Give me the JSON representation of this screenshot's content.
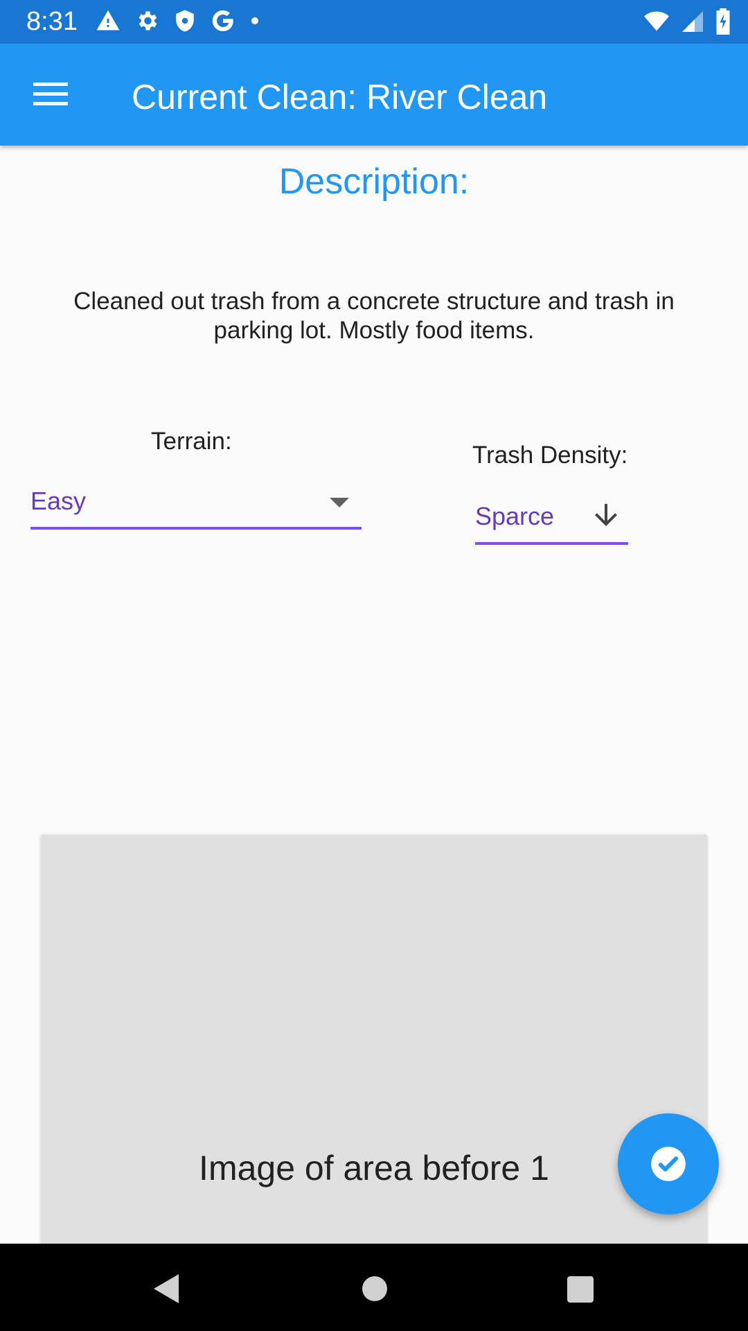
{
  "status_bar": {
    "time": "8:31",
    "left_icons": [
      "alert-icon",
      "settings-icon",
      "shield-icon",
      "google-icon",
      "dot-icon"
    ],
    "right_icons": [
      "wifi-icon",
      "signal-icon",
      "battery-icon"
    ]
  },
  "app_bar": {
    "title": "Current Clean: River Clean",
    "menu_icon": "menu-icon",
    "color": "#2196f3"
  },
  "description": {
    "heading": "Description:",
    "text": "Cleaned out trash from a concrete structure and trash in parking lot. Mostly food items."
  },
  "terrain": {
    "label": "Terrain:",
    "value": "Easy"
  },
  "trash_density": {
    "label": "Trash Density:",
    "value": "Sparce"
  },
  "image_card": {
    "caption": "Image of area before 1"
  },
  "fab": {
    "icon": "check-circle-icon"
  },
  "nav_bar": {
    "icons": [
      "back-icon",
      "home-icon",
      "recents-icon"
    ]
  },
  "colors": {
    "status_bar": "#1976d2",
    "accent": "#2196f3",
    "dropdown_value": "#673ab7",
    "underline": "#7c4dff"
  }
}
